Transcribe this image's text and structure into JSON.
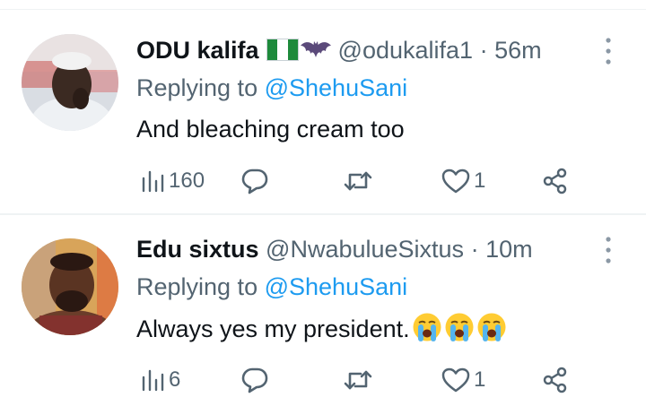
{
  "tweets": [
    {
      "name": "ODU kalifa",
      "handle": "@odukalifa1",
      "separator": "·",
      "time": "56m",
      "reply_prefix": "Replying to",
      "reply_to": "@ShehuSani",
      "text": "And bleaching cream too",
      "views": "160",
      "retweets": "",
      "likes": "1",
      "name_emojis": [
        "nigeria-flag-icon",
        "bat-icon"
      ]
    },
    {
      "name": "Edu sixtus",
      "handle": "@NwabulueSixtus",
      "separator": "·",
      "time": "10m",
      "reply_prefix": "Replying to",
      "reply_to": "@ShehuSani",
      "text": "Always yes my president.",
      "views": "6",
      "retweets": "",
      "likes": "1",
      "text_emojis": [
        "crying-face-icon",
        "crying-face-icon",
        "crying-face-icon"
      ]
    }
  ],
  "colors": {
    "text": "#0f1419",
    "secondary": "#536471",
    "link": "#1d9bf0",
    "divider": "#eff3f4"
  }
}
